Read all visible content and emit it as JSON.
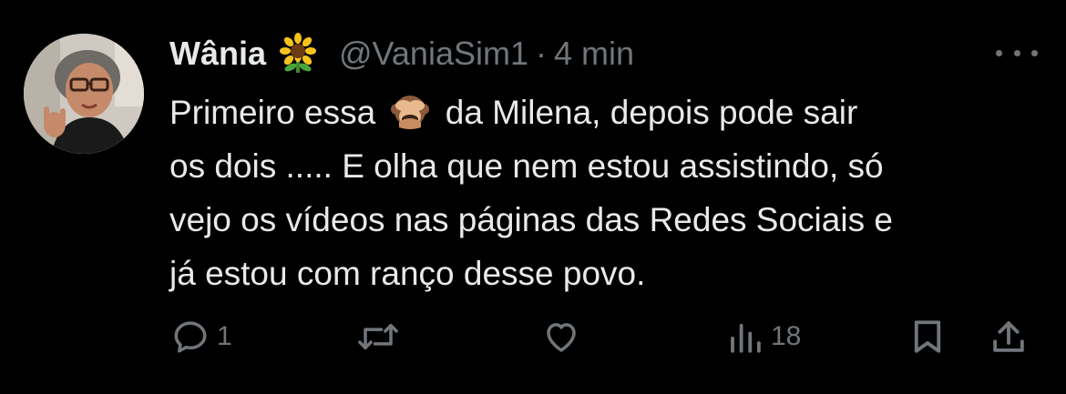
{
  "tweet": {
    "display_name": "Wânia",
    "name_emoji": "sunflower-emoji",
    "handle": "@VaniaSim1",
    "separator": "·",
    "time": "4 min",
    "text_lines": [
      {
        "before": "Primeiro essa",
        "emoji": "see-no-evil-monkey-emoji",
        "after": "da Milena, depois pode sair"
      },
      {
        "text": "os dois ..... E olha que nem estou assistindo, só"
      },
      {
        "text": "vejo os vídeos nas páginas das Redes Sociais e"
      },
      {
        "text": "já estou com ranço desse povo."
      }
    ],
    "actions": {
      "reply_count": "1",
      "retweet_count": "",
      "like_count": "",
      "views_count": "18"
    }
  },
  "colors": {
    "background": "#000000",
    "primary_text": "#e7e9ea",
    "secondary_text": "#71767b"
  },
  "icons": [
    "more-icon",
    "reply-icon",
    "retweet-icon",
    "like-icon",
    "views-icon",
    "bookmark-icon",
    "share-icon"
  ]
}
